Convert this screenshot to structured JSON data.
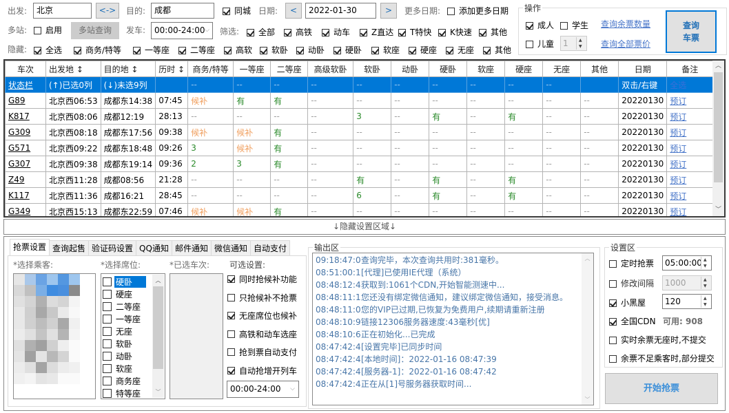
{
  "top": {
    "from_label": "出发:",
    "from_value": "北京",
    "swap_label": "<->",
    "to_label": "目的:",
    "to_value": "成都",
    "same_city_label": "同城",
    "same_city_checked": true,
    "date_label": "日期:",
    "prev_date": "<",
    "date_value": "2022-01-30",
    "next_date": ">",
    "more_dates_label": "更多日期:",
    "add_more_dates_label": "添加更多日期",
    "multi_label": "多站:",
    "multi_enable_label": "启用",
    "multi_query_label": "多站查询",
    "depart_label": "发车:",
    "depart_value": "00:00-24:00",
    "filter_label": "筛选:",
    "filters": [
      "全部",
      "高铁",
      "动车",
      "Z直达",
      "T特快",
      "K快速",
      "其他"
    ],
    "hide_label": "隐藏:",
    "hides": [
      "全选",
      "商务/特等",
      "一等座",
      "二等座",
      "高软",
      "软卧",
      "动卧",
      "硬卧",
      "软座",
      "硬座",
      "无座",
      "其他"
    ]
  },
  "ops": {
    "title": "操作",
    "adult": "成人",
    "student": "学生",
    "child": "儿童",
    "child_count": "1",
    "query_remaining": "查询余票数量",
    "query_prices": "查询全部票价",
    "query_button_line1": "查询",
    "query_button_line2": "车票"
  },
  "table": {
    "headers": [
      "车次",
      "出发地 ↕",
      "目的地 ↕",
      "历时 ↕",
      "商务/特等",
      "一等座",
      "二等座",
      "高级软卧",
      "软卧",
      "动卧",
      "硬卧",
      "软座",
      "硬座",
      "无座",
      "其他",
      "日期",
      "备注"
    ],
    "status_row": [
      "状态栏",
      "(↑)已选0列",
      "(↓)未选9列",
      "",
      "--",
      "--",
      "--",
      "--",
      "--",
      "--",
      "--",
      "--",
      "--",
      "--",
      "",
      "双击/右键",
      "全选"
    ],
    "rows": [
      [
        "G89",
        "北京西06:53",
        "成都东14:38",
        "07:45",
        "候补",
        "有",
        "有",
        "--",
        "--",
        "--",
        "--",
        "--",
        "--",
        "--",
        "--",
        "20220130",
        "预订"
      ],
      [
        "K817",
        "北京西08:06",
        "成都12:19",
        "28:13",
        "--",
        "--",
        "--",
        "--",
        "3",
        "--",
        "有",
        "--",
        "有",
        "--",
        "--",
        "20220130",
        "预订"
      ],
      [
        "G309",
        "北京西08:18",
        "成都东17:56",
        "09:38",
        "候补",
        "候补",
        "有",
        "--",
        "--",
        "--",
        "--",
        "--",
        "--",
        "--",
        "--",
        "20220130",
        "预订"
      ],
      [
        "G571",
        "北京西09:22",
        "成都东18:48",
        "09:26",
        "3",
        "候补",
        "有",
        "--",
        "--",
        "--",
        "--",
        "--",
        "--",
        "--",
        "--",
        "20220130",
        "预订"
      ],
      [
        "G307",
        "北京西09:38",
        "成都东19:14",
        "09:36",
        "2",
        "3",
        "有",
        "--",
        "--",
        "--",
        "--",
        "--",
        "--",
        "--",
        "--",
        "20220130",
        "预订"
      ],
      [
        "Z49",
        "北京西11:28",
        "成都08:56",
        "21:28",
        "--",
        "--",
        "--",
        "--",
        "有",
        "--",
        "有",
        "--",
        "有",
        "--",
        "--",
        "20220130",
        "预订"
      ],
      [
        "K117",
        "北京西11:36",
        "成都16:21",
        "28:45",
        "--",
        "--",
        "--",
        "--",
        "6",
        "--",
        "有",
        "--",
        "有",
        "--",
        "--",
        "20220130",
        "预订"
      ],
      [
        "G349",
        "北京西15:13",
        "成都东22:59",
        "07:46",
        "候补",
        "候补",
        "有",
        "--",
        "--",
        "--",
        "--",
        "--",
        "--",
        "--",
        "--",
        "20220130",
        "预订"
      ]
    ]
  },
  "toggle_bar": "↓隐藏设置区域↓",
  "tabs": [
    "抢票设置",
    "查询起售",
    "验证码设置",
    "QQ通知",
    "邮件通知",
    "微信通知",
    "自动支付"
  ],
  "grab": {
    "passenger_label": "*选择乘客:",
    "seat_label": "*选择席位:",
    "seats": [
      "硬卧",
      "硬座",
      "二等座",
      "一等座",
      "无座",
      "软卧",
      "动卧",
      "软座",
      "商务座",
      "特等座"
    ],
    "selected_trains_label": "*已选车次:",
    "options_label": "可选设置:",
    "options": [
      {
        "label": "同时抢候补功能",
        "checked": true
      },
      {
        "label": "只抢候补不抢票",
        "checked": false
      },
      {
        "label": "无座席位也候补",
        "checked": true
      },
      {
        "label": "高铁和动车选座",
        "checked": false
      },
      {
        "label": "抢到票自动支付",
        "checked": false
      },
      {
        "label": "自动抢增开列车",
        "checked": true
      }
    ],
    "time_range": "00:00-24:00"
  },
  "output": {
    "title": "输出区",
    "lines": [
      {
        "t": "09:18:47:0",
        "m": "查询完毕，本次查询共用时:381毫秒。"
      },
      {
        "t": "08:51:00:1",
        "m": "[代理]已使用IE代理（系统）"
      },
      {
        "t": "08:48:12:4",
        "m": "获取到:1061个CDN,开始智能测速中..."
      },
      {
        "t": "08:48:11:1",
        "m": "您还没有绑定微信通知，建议绑定微信通知，接受消息。"
      },
      {
        "t": "08:48:11:0",
        "m": "您的VIP已过期,已恢复为免费用户,续期请重新注册"
      },
      {
        "t": "08:48:10:9",
        "m": "链接12306服务器速度:43毫秒[优]"
      },
      {
        "t": "08:48:10:6",
        "m": "正在初始化...已完成"
      },
      {
        "t": "08:47:42:4",
        "m": "[设置完毕]已同步时间"
      },
      {
        "t": "08:47:42:4",
        "m": "[本地时间]：2022-01-16 08:47:39"
      },
      {
        "t": "08:47:42:4",
        "m": "[服务器-1]：2022-01-16 08:47:42"
      },
      {
        "t": "08:47:42:4",
        "m": "正在从[1]号服务器获取时间..."
      }
    ]
  },
  "settings": {
    "title": "设置区",
    "timed_label": "定时抢票",
    "timed_value": "05:00:00",
    "interval_label": "修改间隔",
    "interval_value": "1000",
    "blackroom_label": "小黑屋",
    "blackroom_value": "120",
    "cdn_label": "全国CDN",
    "cdn_available": "可用: 908",
    "no_seat_label": "实时余票无座时,不提交",
    "partial_label": "余票不足乘客时,部分提交",
    "start_button": "开始抢票"
  },
  "colors": {
    "selection": "#0078d7",
    "available": "#2a8a2a",
    "waitlist": "#f0a060",
    "link": "#4876c9",
    "log": "#4876a8"
  }
}
